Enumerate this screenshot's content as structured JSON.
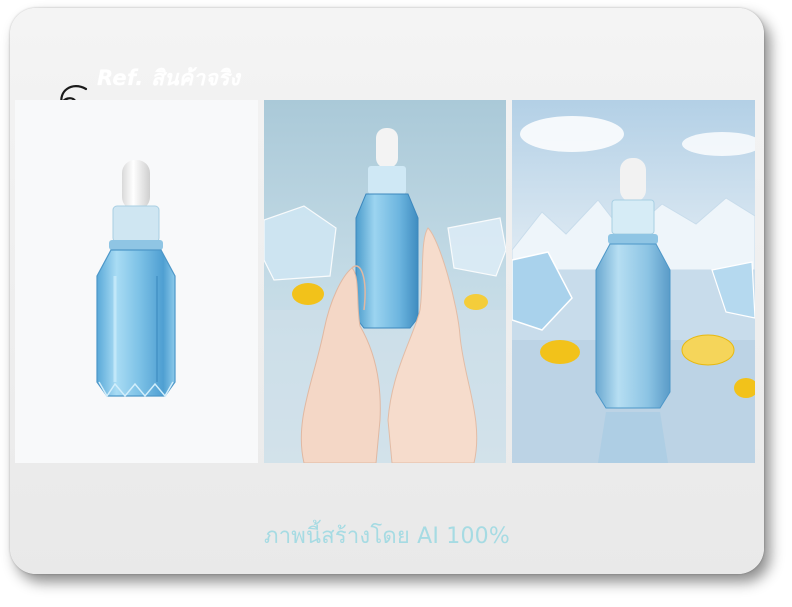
{
  "header": {
    "ref_label": "Ref. สินค้าจริง"
  },
  "panels": [
    {
      "name": "product-reference-photo",
      "icon": "dropper-bottle"
    },
    {
      "name": "hands-holding-bottle-scene",
      "icon": "hands-with-bottle"
    },
    {
      "name": "ice-landscape-scene",
      "icon": "bottle-on-ice"
    }
  ],
  "footer": {
    "caption": "ภาพนี้สร้างโดย AI 100%"
  },
  "colors": {
    "bottle_blue": "#7fc3e6",
    "caption_teal": "#a6dbe3",
    "ice_sky": "#c9dded",
    "lemon": "#f2c21a"
  }
}
